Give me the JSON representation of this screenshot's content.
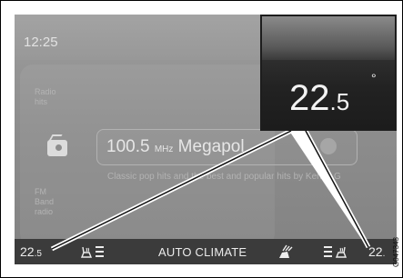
{
  "status_bar": {
    "clock": "12:25"
  },
  "left_panel": {
    "radio_label": "Radio\nhits",
    "source_label": "FM\nBand\nradio"
  },
  "station": {
    "frequency": "100.5",
    "unit": "MHz",
    "name": "Megapol"
  },
  "rds_text": "Classic pop hits and the best and popular hits by Kenny G",
  "climate_bar": {
    "left_temp_whole": "22",
    "left_temp_decimal": ".5",
    "label": "AUTO CLIMATE",
    "right_temp_whole": "22",
    "right_temp_decimal": "."
  },
  "callout": {
    "temp_whole": "22",
    "temp_decimal": ".5",
    "degree": "°"
  },
  "figure_code": "G047343",
  "colors": {
    "climate_bar": "#3b3b3b",
    "screen": "#8d8d8d",
    "callout": "#1e1e1e"
  },
  "icons": [
    "radio-icon",
    "seat-heat-icon",
    "fan-icon",
    "favorite-icon"
  ]
}
